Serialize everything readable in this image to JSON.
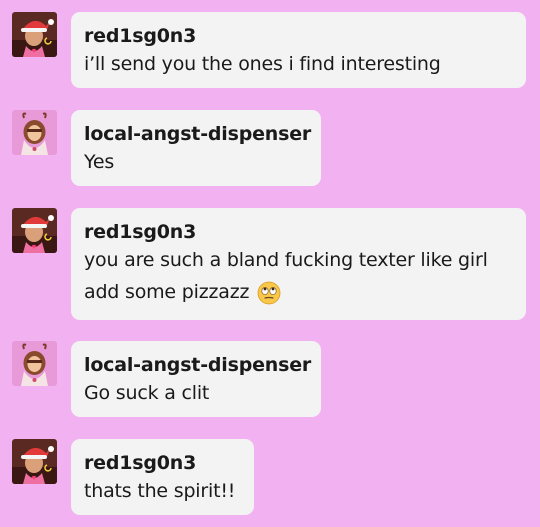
{
  "messages": [
    {
      "sender": "red1sg0n3",
      "text": "i’ll send you the ones i find interesting"
    },
    {
      "sender": "local-angst-dispenser",
      "text": "Yes"
    },
    {
      "sender": "red1sg0n3",
      "text_line1": "you are such a bland fucking texter like girl",
      "text_line2": "add some pizzazz",
      "emoji": "rolling-eyes-emoji"
    },
    {
      "sender": "local-angst-dispenser",
      "text": "Go suck a clit"
    },
    {
      "sender": "red1sg0n3",
      "text": "thats the spirit!!"
    }
  ],
  "colors": {
    "background": "#f2b2f1",
    "bubble": "#f3f3f3",
    "text": "#1a1a1a"
  }
}
